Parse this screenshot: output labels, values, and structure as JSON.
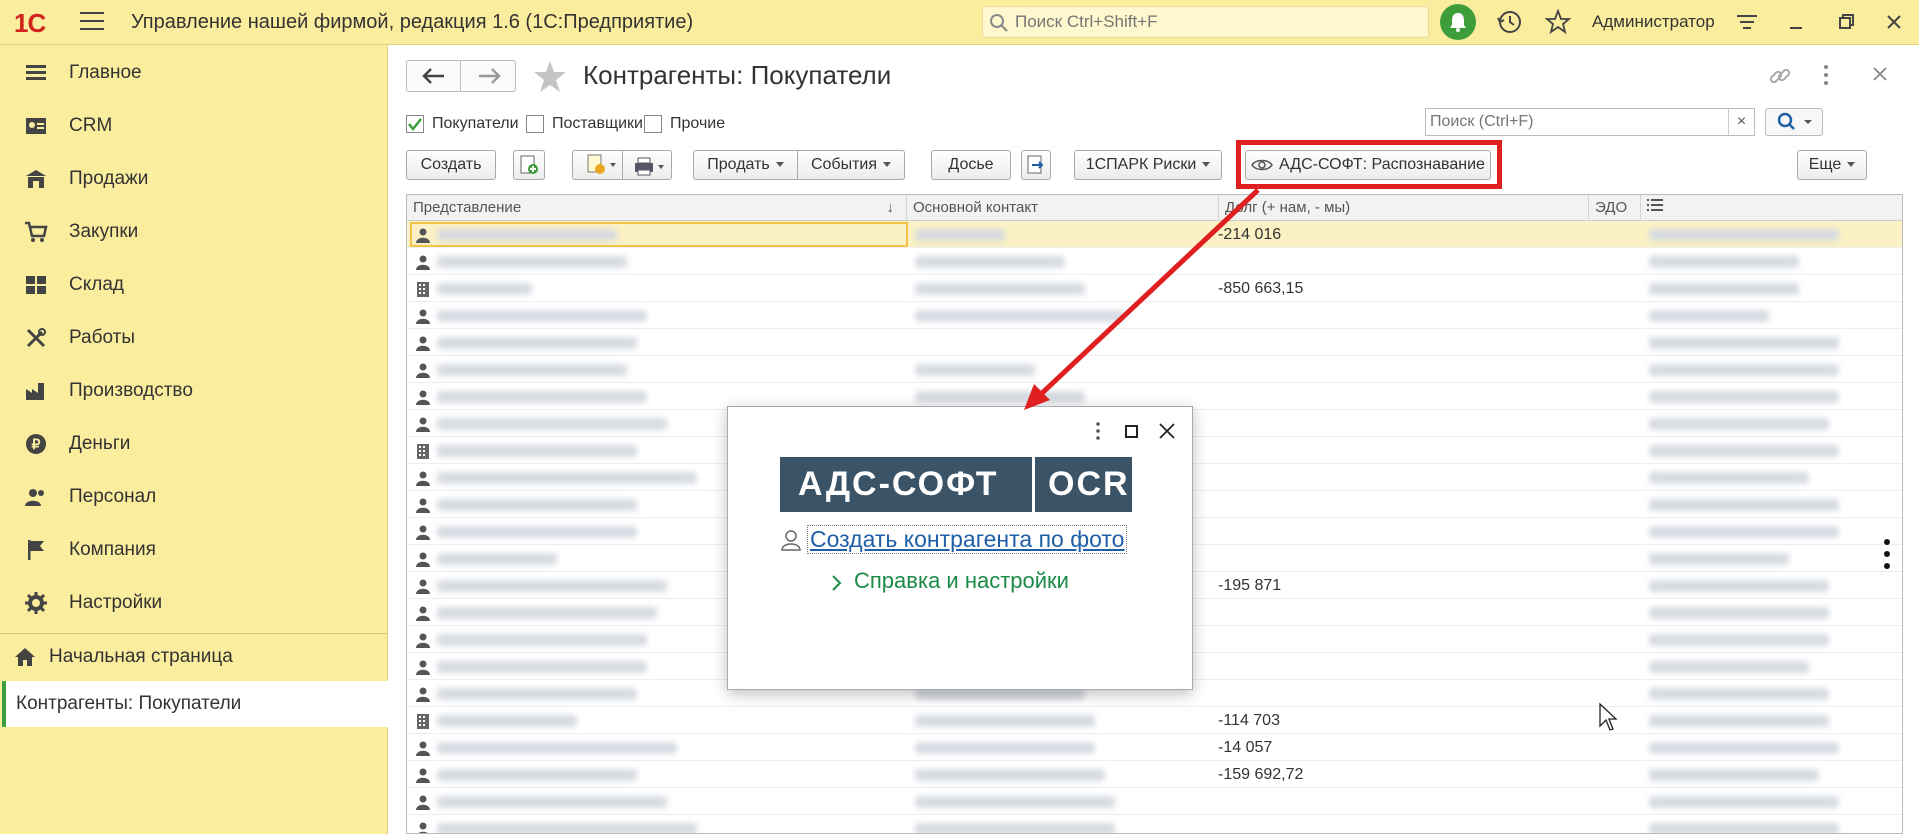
{
  "app": {
    "logo": "1С",
    "title": "Управление нашей фирмой, редакция 1.6  (1С:Предприятие)",
    "search_placeholder": "Поиск Ctrl+Shift+F",
    "user": "Администратор"
  },
  "sidebar": {
    "items": [
      {
        "label": "Главное",
        "icon": "list-icon"
      },
      {
        "label": "CRM",
        "icon": "contacts-icon"
      },
      {
        "label": "Продажи",
        "icon": "shop-icon"
      },
      {
        "label": "Закупки",
        "icon": "cart-icon"
      },
      {
        "label": "Склад",
        "icon": "warehouse-icon"
      },
      {
        "label": "Работы",
        "icon": "tools-icon"
      },
      {
        "label": "Производство",
        "icon": "factory-icon"
      },
      {
        "label": "Деньги",
        "icon": "ruble-icon"
      },
      {
        "label": "Персонал",
        "icon": "people-icon"
      },
      {
        "label": "Компания",
        "icon": "flag-icon"
      },
      {
        "label": "Настройки",
        "icon": "gear-icon"
      }
    ],
    "home": "Начальная страница",
    "open_form": "Контрагенты: Покупатели"
  },
  "form": {
    "title": "Контрагенты: Покупатели",
    "filters": [
      {
        "label": "Покупатели",
        "checked": true
      },
      {
        "label": "Поставщики",
        "checked": false
      },
      {
        "label": "Прочие",
        "checked": false
      }
    ],
    "search_placeholder": "Поиск (Ctrl+F)",
    "search_clear": "×",
    "buttons": {
      "create": "Создать",
      "sell": "Продать",
      "events": "События",
      "dossier": "Досье",
      "spark": "1СПАРК Риски",
      "ads": "АДС-СОФТ: Распознавание",
      "more": "Еще"
    }
  },
  "table": {
    "columns": [
      "Представление",
      "Основной контакт",
      "Долг (+ нам, - мы)",
      "ЭДО",
      ""
    ],
    "sort_indicator": "↓",
    "rows": [
      {
        "type": "person",
        "debt": "-214 016"
      },
      {
        "type": "person",
        "debt": ""
      },
      {
        "type": "company",
        "debt": "-850 663,15"
      },
      {
        "type": "person",
        "debt": ""
      },
      {
        "type": "person",
        "debt": ""
      },
      {
        "type": "person",
        "debt": ""
      },
      {
        "type": "person",
        "debt": ""
      },
      {
        "type": "person",
        "debt": ""
      },
      {
        "type": "company",
        "debt": ""
      },
      {
        "type": "person",
        "debt": ""
      },
      {
        "type": "person",
        "debt": ""
      },
      {
        "type": "person",
        "debt": ""
      },
      {
        "type": "person",
        "debt": ""
      },
      {
        "type": "person",
        "debt": "-195 871"
      },
      {
        "type": "person",
        "debt": ""
      },
      {
        "type": "person",
        "debt": ""
      },
      {
        "type": "person",
        "debt": ""
      },
      {
        "type": "person",
        "debt": ""
      },
      {
        "type": "company",
        "debt": "-114 703"
      },
      {
        "type": "person",
        "debt": "-14 057"
      },
      {
        "type": "person",
        "debt": "-159 692,72"
      },
      {
        "type": "person",
        "debt": ""
      },
      {
        "type": "person",
        "debt": ""
      }
    ]
  },
  "popup": {
    "logo_left": "АДС-СОФТ",
    "logo_right": "OCR",
    "create_link": "Создать контрагента по фото",
    "help_link": "Справка и настройки"
  },
  "colors": {
    "accent_yellow": "#fbed9e",
    "brand_red": "#d2231f",
    "highlight_red": "#e02020",
    "green": "#3c9d3a",
    "ocr_blue": "#3b5366"
  }
}
